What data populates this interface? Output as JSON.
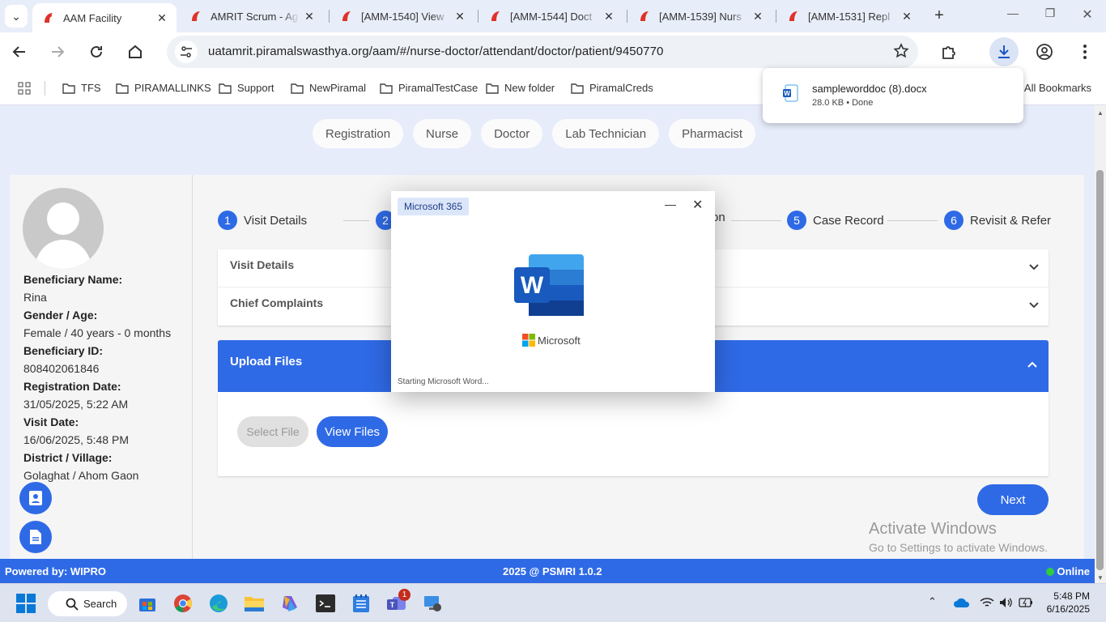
{
  "browser": {
    "tabs": [
      {
        "title": "AAM Facility",
        "active": true
      },
      {
        "title": "AMRIT Scrum - Ag",
        "active": false
      },
      {
        "title": "[AMM-1540] View",
        "active": false
      },
      {
        "title": "[AMM-1544] Doct",
        "active": false
      },
      {
        "title": "[AMM-1539] Nurs",
        "active": false
      },
      {
        "title": "[AMM-1531] Repl",
        "active": false
      }
    ],
    "url": "uatamrit.piramalswasthya.org/aam/#/nurse-doctor/attendant/doctor/patient/9450770",
    "bookmarks": [
      "TFS",
      "PIRAMALLINKS",
      "Support",
      "NewPiramal",
      "PiramalTestCase",
      "New folder",
      "PiramalCreds"
    ],
    "all_bookmarks": "All Bookmarks"
  },
  "download": {
    "filename": "sampleworddoc (8).docx",
    "status": "28.0 KB • Done"
  },
  "roles": [
    "Registration",
    "Nurse",
    "Doctor",
    "Lab Technician",
    "Pharmacist"
  ],
  "beneficiary": {
    "name_label": "Beneficiary Name:",
    "name": "Rina",
    "gender_label": "Gender / Age:",
    "gender": "Female / 40 years - 0 months",
    "id_label": "Beneficiary ID:",
    "id": "808402061846",
    "reg_label": "Registration Date:",
    "reg": "31/05/2025, 5:22 AM",
    "visit_label": "Visit Date:",
    "visit": "16/06/2025, 5:48 PM",
    "district_label": "District / Village:",
    "district": "Golaghat / Ahom Gaon"
  },
  "steps": [
    {
      "num": "1",
      "label": "Visit Details"
    },
    {
      "num": "2",
      "label": ""
    },
    {
      "num": "",
      "label": "on"
    },
    {
      "num": "5",
      "label": "Case Record"
    },
    {
      "num": "6",
      "label": "Revisit & Refer"
    }
  ],
  "accordion": {
    "visit_details": "Visit Details",
    "chief_complaints": "Chief Complaints",
    "upload_files": "Upload Files"
  },
  "buttons": {
    "select_file": "Select File",
    "view_files": "View Files",
    "next": "Next"
  },
  "footer": {
    "powered": "Powered by: WIPRO",
    "copyright": "2025 @ PSMRI 1.0.2",
    "status": "Online"
  },
  "watermark": {
    "line1": "Activate Windows",
    "line2": "Go to Settings to activate Windows."
  },
  "word_splash": {
    "badge": "Microsoft 365",
    "brand": "Microsoft",
    "status": "Starting Microsoft Word..."
  },
  "taskbar": {
    "search": "Search",
    "time": "5:48 PM",
    "date": "6/16/2025",
    "teams_badge": "1"
  },
  "colors": {
    "primary": "#2f6ae6",
    "online": "#2ecc40",
    "word_blue": "#185abd"
  }
}
